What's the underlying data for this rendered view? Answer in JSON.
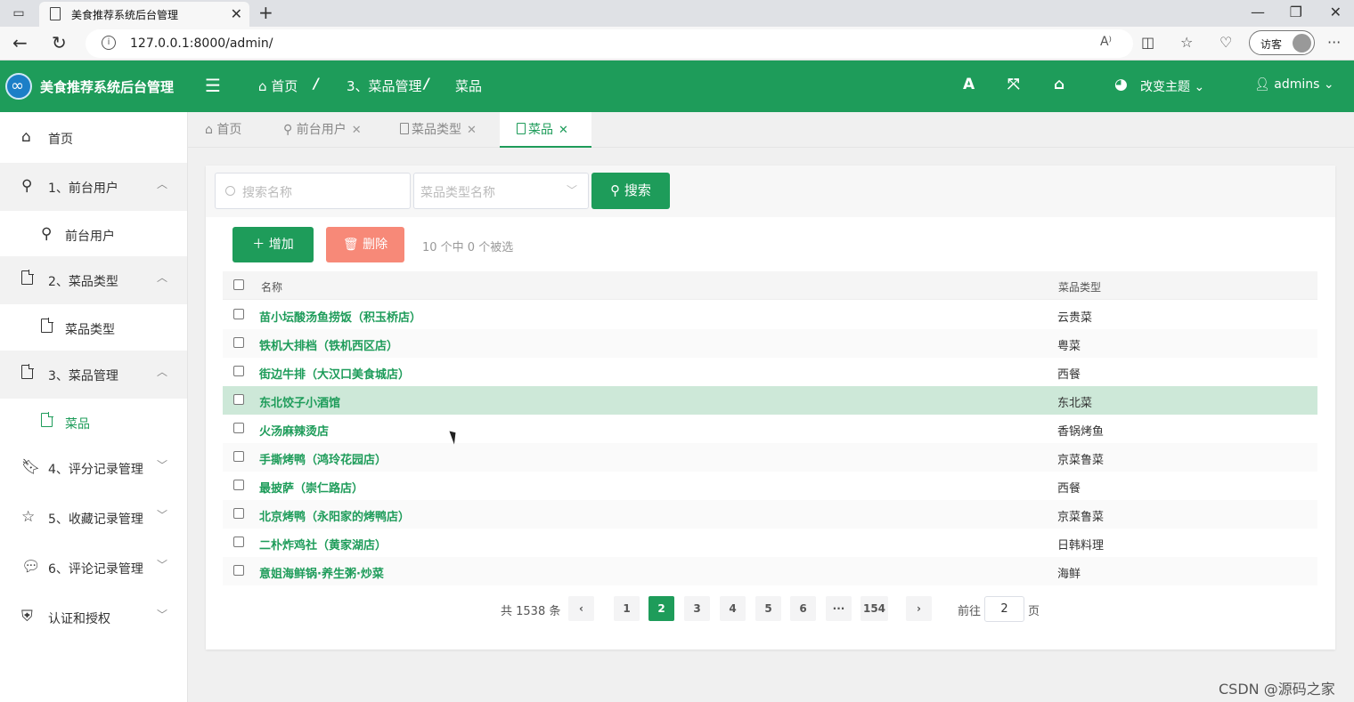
{
  "browser": {
    "tab_title": "美食推荐系统后台管理",
    "url": "127.0.0.1:8000/admin/",
    "profile_label": "访客",
    "read_aloud": "A⁾"
  },
  "header": {
    "app_title": "美食推荐系统后台管理",
    "breadcrumb": [
      "首页",
      "3、菜品管理",
      "菜品"
    ],
    "font_icon": "A",
    "theme_label": "改变主题",
    "user_label": "admins",
    "accent_color": "#1e9c5a"
  },
  "sidebar": {
    "items": [
      {
        "label": "首页",
        "icon": "home-icon"
      },
      {
        "label": "1、前台用户",
        "icon": "user-icon"
      },
      {
        "label": "前台用户",
        "icon": "user-icon"
      },
      {
        "label": "2、菜品类型",
        "icon": "file-icon"
      },
      {
        "label": "菜品类型",
        "icon": "file-icon"
      },
      {
        "label": "3、菜品管理",
        "icon": "file-icon"
      },
      {
        "label": "菜品",
        "icon": "file-icon"
      },
      {
        "label": "4、评分记录管理",
        "icon": "bookmark-icon"
      },
      {
        "label": "5、收藏记录管理",
        "icon": "star-icon"
      },
      {
        "label": "6、评论记录管理",
        "icon": "comments-icon"
      },
      {
        "label": "认证和授权",
        "icon": "shield-icon"
      }
    ]
  },
  "tags": [
    "首页",
    "前台用户",
    "菜品类型",
    "菜品"
  ],
  "search": {
    "name_placeholder": "搜索名称",
    "type_placeholder": "菜品类型名称",
    "button_label": "搜索"
  },
  "actions": {
    "add_label": "增加",
    "delete_label": "删除",
    "selection_text": "10 个中 0 个被选"
  },
  "table": {
    "columns": [
      "名称",
      "菜品类型"
    ],
    "rows": [
      {
        "name": "苗小坛酸汤鱼捞饭（积玉桥店）",
        "type": "云贵菜"
      },
      {
        "name": "铁机大排档（铁机西区店）",
        "type": "粤菜"
      },
      {
        "name": "街边牛排（大汉口美食城店）",
        "type": "西餐"
      },
      {
        "name": "东北饺子小酒馆",
        "type": "东北菜"
      },
      {
        "name": "火汤麻辣烫店",
        "type": "香锅烤鱼"
      },
      {
        "name": "手撕烤鸭（鸿玲花园店）",
        "type": "京菜鲁菜"
      },
      {
        "name": "最披萨（崇仁路店）",
        "type": "西餐"
      },
      {
        "name": "北京烤鸭（永阳家的烤鸭店）",
        "type": "京菜鲁菜"
      },
      {
        "name": "二朴炸鸡社（黄家湖店）",
        "type": "日韩料理"
      },
      {
        "name": "意姐海鲜锅·养生粥·炒菜",
        "type": "海鲜"
      }
    ]
  },
  "pagination": {
    "total_text": "共 1538 条",
    "pages": [
      "1",
      "2",
      "3",
      "4",
      "5",
      "6",
      "···",
      "154"
    ],
    "current": "2",
    "goto_label": "前往",
    "goto_value": "2",
    "unit": "页"
  },
  "watermark": "CSDN @源码之家"
}
